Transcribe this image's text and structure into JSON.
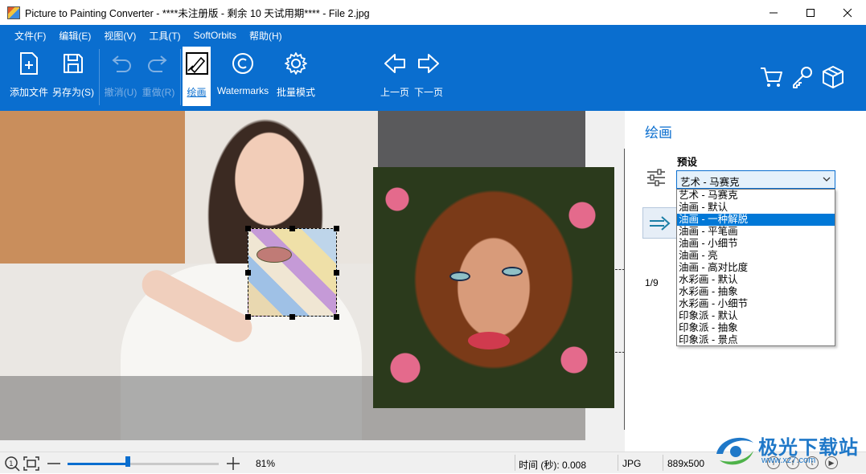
{
  "window": {
    "title": "Picture to Painting Converter - ****未注册版 - 剩余 10 天试用期**** - File 2.jpg",
    "controls": [
      "minimize",
      "maximize",
      "close"
    ]
  },
  "menu": [
    "文件(F)",
    "编辑(E)",
    "视图(V)",
    "工具(T)",
    "SoftOrbits",
    "帮助(H)"
  ],
  "toolbar": {
    "add_file": "添加文件",
    "save_as": "另存为(S)",
    "undo": "撤消(U)",
    "redo": "重做(R)",
    "paint": "绘画",
    "watermarks": "Watermarks",
    "batch_mode": "批量模式",
    "prev_page": "上一页",
    "next_page": "下一页"
  },
  "panel": {
    "title": "绘画",
    "preset_label": "预设",
    "preset_selected": "艺术 - 马赛克",
    "page_counter": "1/9",
    "options": [
      "艺术 - 马赛克",
      "油画 - 默认",
      "油画 - 一种解脱",
      "油画 - 平笔画",
      "油画 - 小细节",
      "油画 - 亮",
      "油画 - 高对比度",
      "水彩画 - 默认",
      "水彩画 - 抽象",
      "水彩画 - 小细节",
      "印象派 - 默认",
      "印象派 - 抽象",
      "印象派 - 景点"
    ],
    "highlighted_index": 2
  },
  "status": {
    "zoom": "81%",
    "zoom_level": 0.4,
    "time": "时间 (秒): 0.008",
    "format": "JPG",
    "size": "889x500"
  },
  "watermark": {
    "text": "极光下载站",
    "url": "www.xz7.com"
  },
  "colors": {
    "accent": "#0a6ecf",
    "highlight": "#0078d7"
  }
}
